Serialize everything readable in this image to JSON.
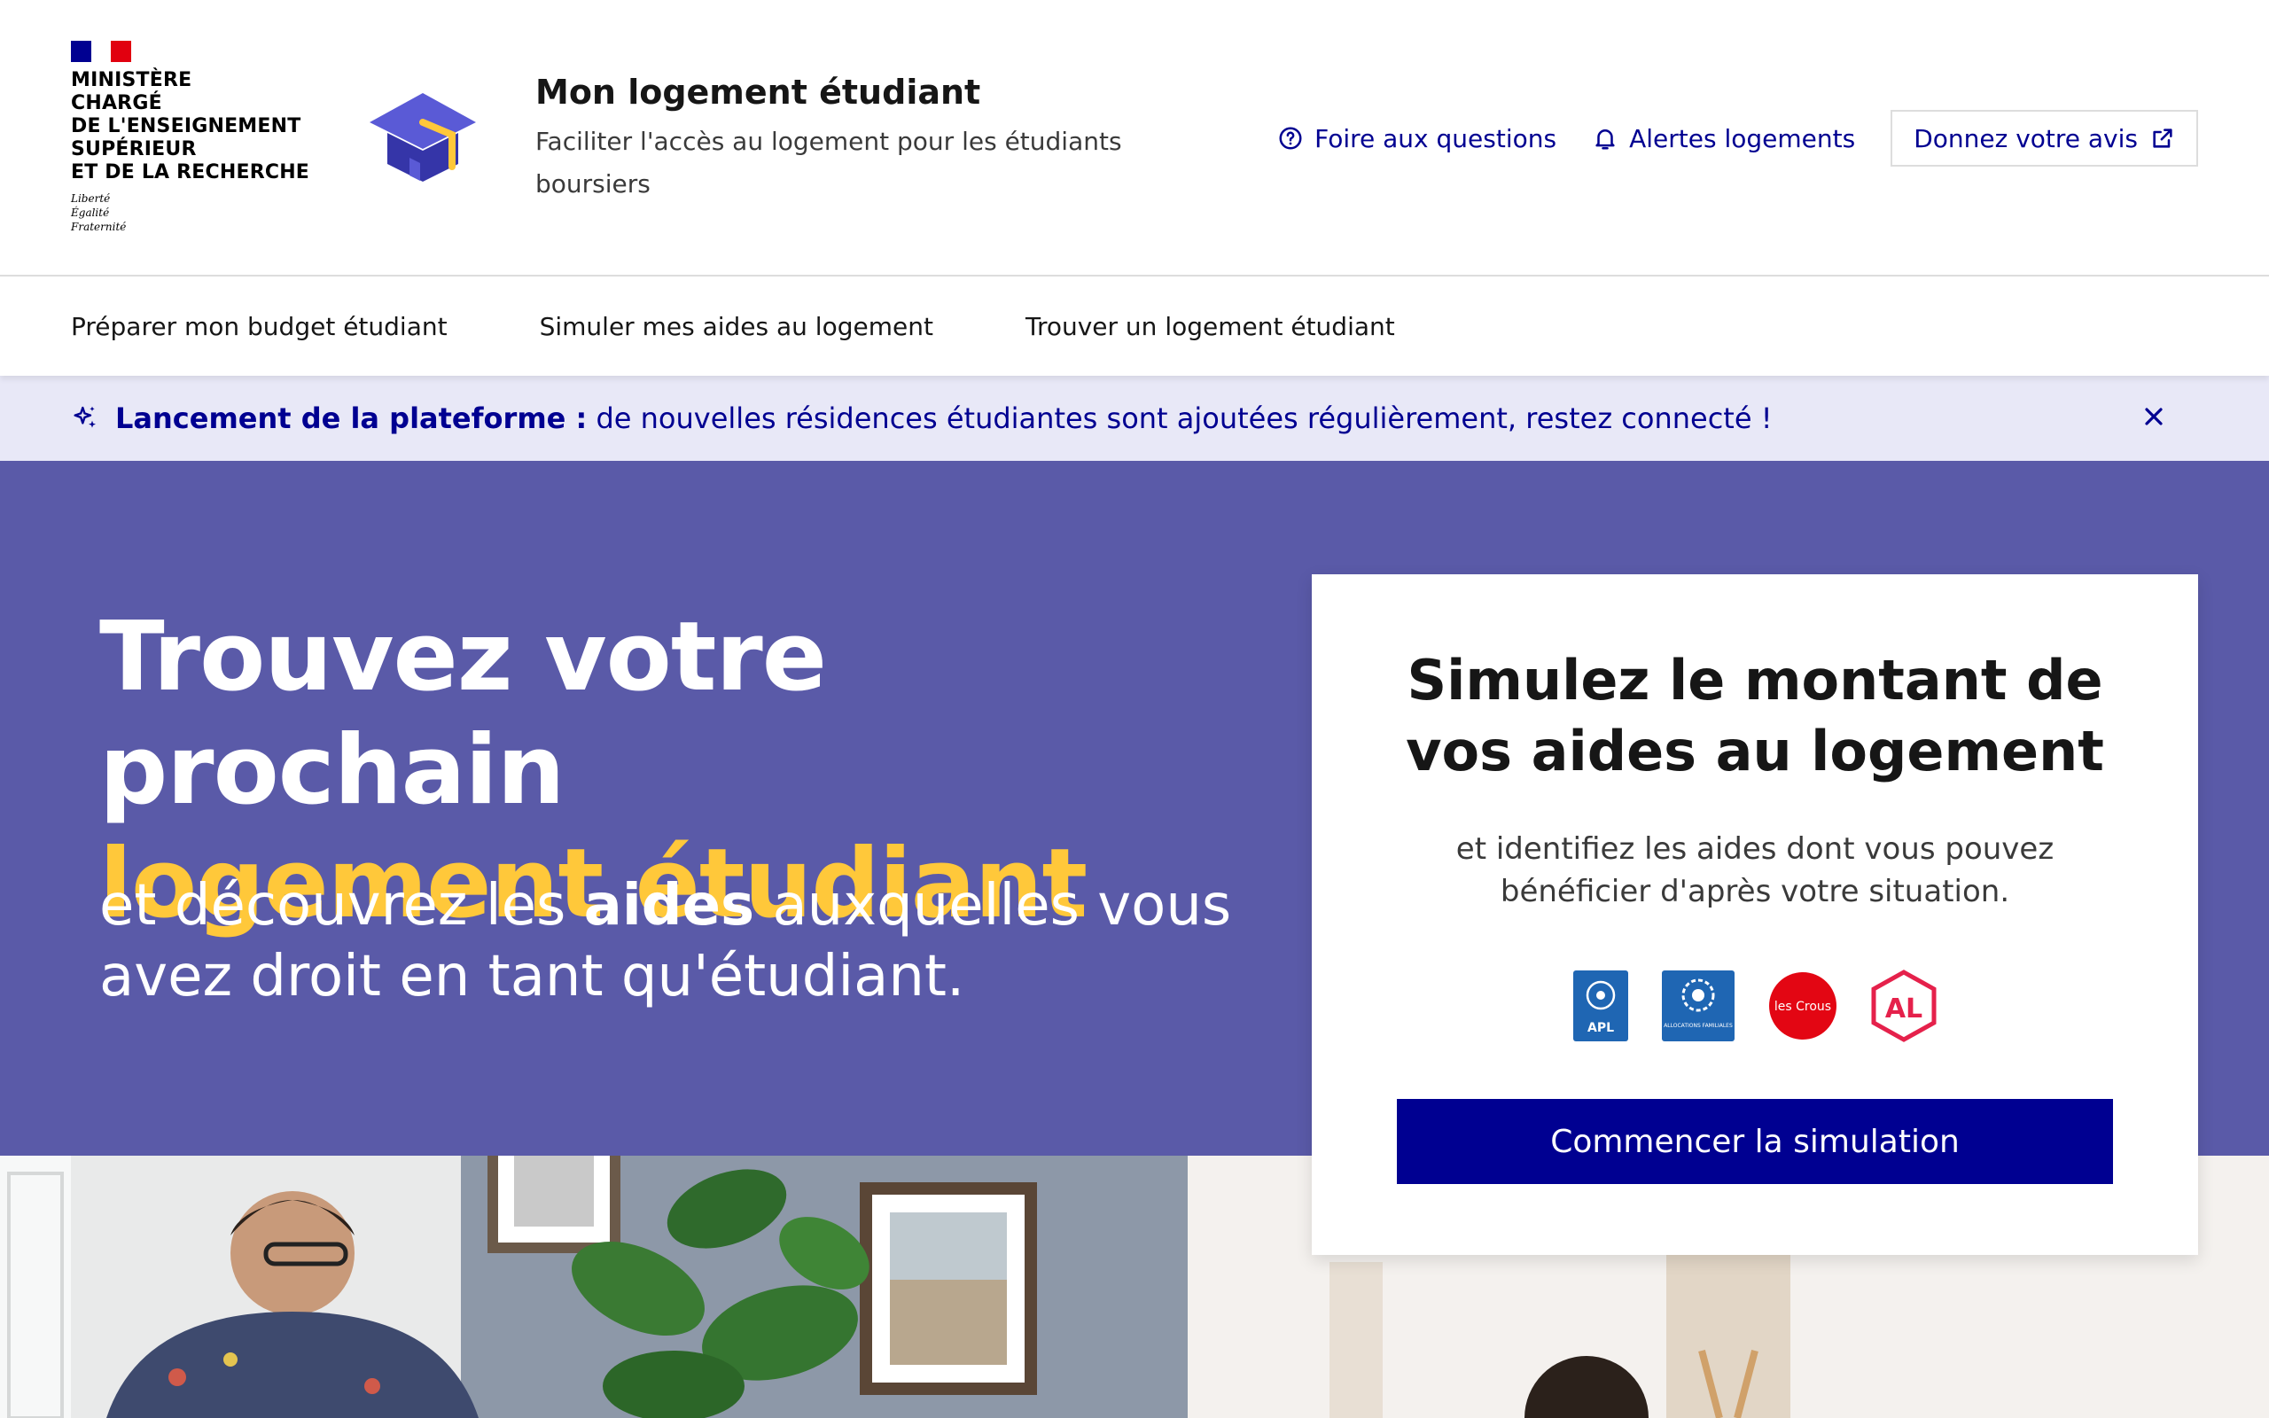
{
  "header": {
    "ministry_lines": [
      "MINISTÈRE",
      "CHARGÉ",
      "DE L'ENSEIGNEMENT",
      "SUPÉRIEUR",
      "ET DE LA RECHERCHE"
    ],
    "motto_lines": [
      "Liberté",
      "Égalité",
      "Fraternité"
    ],
    "site_title": "Mon logement étudiant",
    "site_tagline": "Faciliter l'accès au logement pour les étudiants boursiers",
    "links": {
      "faq": "Foire aux questions",
      "alerts": "Alertes logements",
      "feedback": "Donnez votre avis"
    }
  },
  "nav": {
    "items": [
      "Préparer mon budget étudiant",
      "Simuler mes aides au logement",
      "Trouver un logement étudiant"
    ]
  },
  "notice": {
    "strong": "Lancement de la plateforme :",
    "text": " de nouvelles résidences étudiantes sont ajoutées régulièrement, restez connecté !"
  },
  "hero": {
    "title_line1": "Trouvez votre prochain",
    "title_line2": "logement étudiant",
    "sub_pre": "et découvrez les ",
    "sub_bold": "aides",
    "sub_post": " auxquelles vous avez droit en tant qu'étudiant."
  },
  "card": {
    "title": "Simulez le montant de vos aides au logement",
    "subtitle": "et identifiez les aides dont vous pouvez bénéficier d'après votre situation.",
    "logos": {
      "apl": "APL",
      "caf": "ALLOCATIONS FAMILIALES",
      "crous": "les Crous",
      "al": "AL"
    },
    "button": "Commencer la simulation"
  },
  "colors": {
    "brand_blue": "#000091",
    "hero_bg": "#5a5aa8",
    "accent_yellow": "#ffc83a",
    "notice_bg": "#e8e8f7"
  }
}
